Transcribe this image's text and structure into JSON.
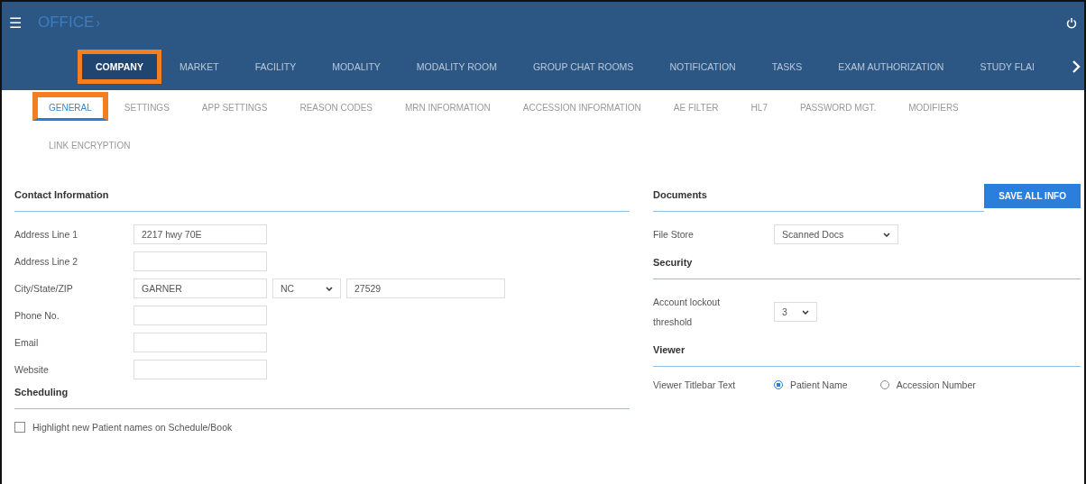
{
  "header": {
    "menu_icon": "☰",
    "title": "OFFICE",
    "title_mark": "›"
  },
  "main_tabs": [
    {
      "label": "COMPANY",
      "selected": true,
      "highlighted": true
    },
    {
      "label": "MARKET",
      "selected": false,
      "highlighted": false
    },
    {
      "label": "FACILITY",
      "selected": false,
      "highlighted": false
    },
    {
      "label": "MODALITY",
      "selected": false,
      "highlighted": false
    },
    {
      "label": "MODALITY ROOM",
      "selected": false,
      "highlighted": false
    },
    {
      "label": "GROUP CHAT ROOMS",
      "selected": false,
      "highlighted": false
    },
    {
      "label": "NOTIFICATION",
      "selected": false,
      "highlighted": false
    },
    {
      "label": "TASKS",
      "selected": false,
      "highlighted": false
    },
    {
      "label": "EXAM AUTHORIZATION",
      "selected": false,
      "highlighted": false
    },
    {
      "label": "STUDY FLAI",
      "selected": false,
      "highlighted": false
    }
  ],
  "sub_tabs": [
    {
      "label": "GENERAL",
      "selected": true,
      "highlighted": true
    },
    {
      "label": "SETTINGS",
      "selected": false,
      "highlighted": false
    },
    {
      "label": "APP SETTINGS",
      "selected": false,
      "highlighted": false
    },
    {
      "label": "REASON CODES",
      "selected": false,
      "highlighted": false
    },
    {
      "label": "MRN INFORMATION",
      "selected": false,
      "highlighted": false
    },
    {
      "label": "ACCESSION INFORMATION",
      "selected": false,
      "highlighted": false
    },
    {
      "label": "AE FILTER",
      "selected": false,
      "highlighted": false
    },
    {
      "label": "HL7",
      "selected": false,
      "highlighted": false
    },
    {
      "label": "PASSWORD MGT.",
      "selected": false,
      "highlighted": false
    },
    {
      "label": "MODIFIERS",
      "selected": false,
      "highlighted": false
    },
    {
      "label": "LINK ENCRYPTION",
      "selected": false,
      "highlighted": false
    }
  ],
  "contact": {
    "title": "Contact Information",
    "fields": [
      {
        "label": "Address Line 1",
        "value": "2217 hwy 70E"
      },
      {
        "label": "Address Line 2"
      },
      {
        "label": "City/State/ZIP",
        "value": "GARNER",
        "state": "NC",
        "zip": "27529"
      },
      {
        "label": "Phone No."
      },
      {
        "label": "Email"
      },
      {
        "label": "Website"
      }
    ]
  },
  "scheduling": {
    "title": "Scheduling",
    "options": [
      {
        "label": "Highlight new Patient names on Schedule/Book",
        "checked": false
      }
    ]
  },
  "documents": {
    "title": "Documents",
    "save_button": "SAVE ALL INFO",
    "file_store_label": "File Store",
    "file_store": "Scanned Docs"
  },
  "security": {
    "title": "Security",
    "lockout_label": "Account lockout threshold",
    "lockout": "3"
  },
  "viewer": {
    "title": "Viewer",
    "label": "Viewer Titlebar Text",
    "options": [
      {
        "label": "Patient Name",
        "selected": true
      },
      {
        "label": "Accession Number",
        "selected": false
      }
    ]
  }
}
